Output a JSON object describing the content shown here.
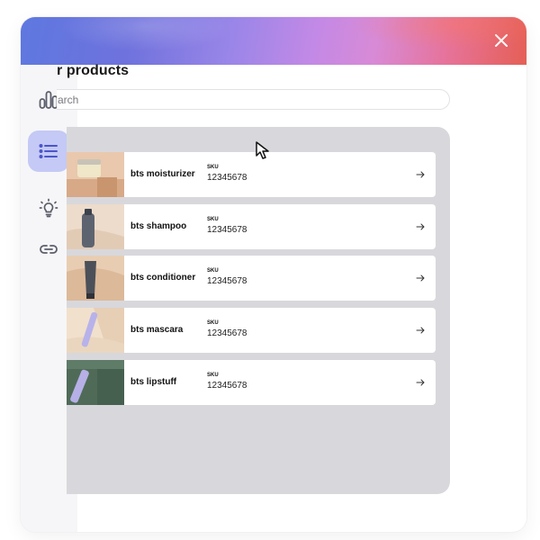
{
  "page": {
    "title": "r products"
  },
  "search": {
    "placeholder": "arch",
    "value": ""
  },
  "sidebar": {
    "items": [
      {
        "name": "analytics",
        "icon": "bar-chart-icon",
        "active": false
      },
      {
        "name": "products",
        "icon": "list-icon",
        "active": true
      },
      {
        "name": "ideas",
        "icon": "lightbulb-icon",
        "active": false
      },
      {
        "name": "links",
        "icon": "link-icon",
        "active": false
      }
    ]
  },
  "products": [
    {
      "name": "bts moisturizer",
      "sku_label": "SKU",
      "sku": "12345678",
      "thumb": "moisturizer-jar"
    },
    {
      "name": "bts shampoo",
      "sku_label": "SKU",
      "sku": "12345678",
      "thumb": "shampoo-bottle"
    },
    {
      "name": "bts conditioner",
      "sku_label": "SKU",
      "sku": "12345678",
      "thumb": "conditioner-tube"
    },
    {
      "name": "bts mascara",
      "sku_label": "SKU",
      "sku": "12345678",
      "thumb": "mascara-wand"
    },
    {
      "name": "bts lipstuff",
      "sku_label": "SKU",
      "sku": "12345678",
      "thumb": "lipstuff-tube"
    }
  ],
  "colors": {
    "accent": "#c4c9f5",
    "icon": "#5b5e6b",
    "active_icon": "#4a55c9",
    "panel": "#d8d8dc"
  }
}
